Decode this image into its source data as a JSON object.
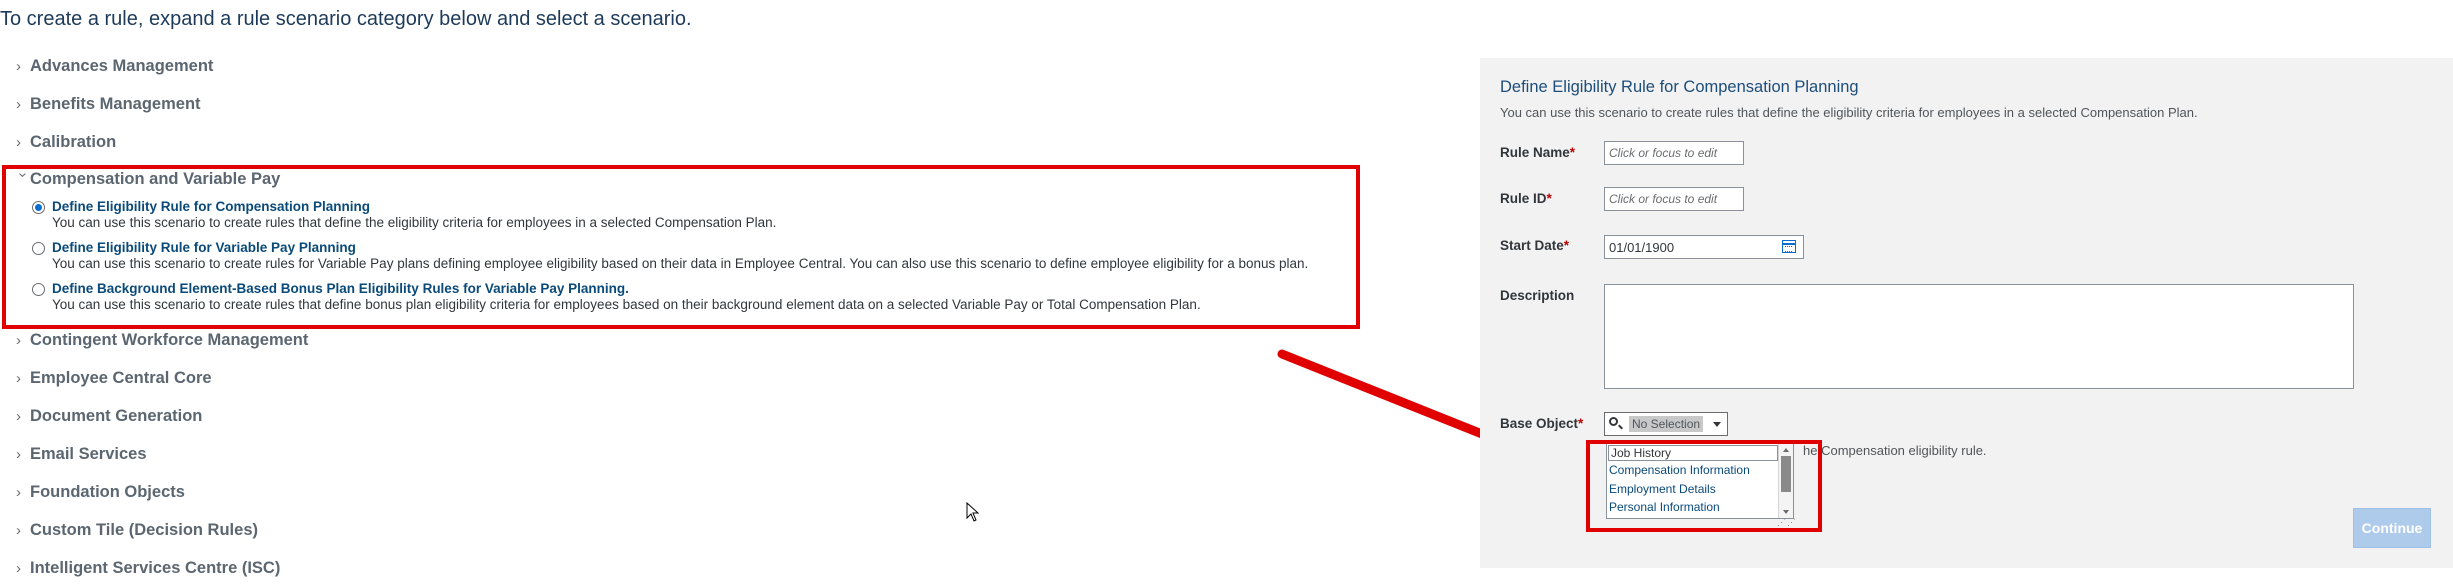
{
  "intro": "To create a rule, expand a rule scenario category below and select a scenario.",
  "categories_top": [
    "Advances Management",
    "Benefits Management",
    "Calibration"
  ],
  "expanded_category": {
    "label": "Compensation and Variable Pay",
    "options": [
      {
        "title": "Define Eligibility Rule for Compensation Planning",
        "desc": "You can use this scenario to create rules that define the eligibility criteria for employees in a selected Compensation Plan.",
        "selected": true
      },
      {
        "title": "Define Eligibility Rule for Variable Pay Planning",
        "desc": "You can use this scenario to create rules for Variable Pay plans defining employee eligibility based on their data in Employee Central. You can also use this scenario to define employee eligibility for a bonus plan.",
        "selected": false
      },
      {
        "title": "Define Background Element-Based Bonus Plan Eligibility Rules for Variable Pay Planning.",
        "desc": "You can use this scenario to create rules that define bonus plan eligibility criteria for employees based on their background element data on a selected Variable Pay or Total Compensation Plan.",
        "selected": false
      }
    ]
  },
  "categories_bottom": [
    "Contingent Workforce Management",
    "Employee Central Core",
    "Document Generation",
    "Email Services",
    "Foundation Objects",
    "Custom Tile (Decision Rules)",
    "Intelligent Services Centre (ISC)"
  ],
  "panel": {
    "title": "Define Eligibility Rule for Compensation Planning",
    "subtitle": "You can use this scenario to create rules that define the eligibility criteria for employees in a selected Compensation Plan.",
    "rule_name_label": "Rule Name",
    "rule_name_placeholder": "Click or focus to edit",
    "rule_id_label": "Rule ID",
    "rule_id_placeholder": "Click or focus to edit",
    "start_date_label": "Start Date",
    "start_date_value": "01/01/1900",
    "description_label": "Description",
    "base_object_label": "Base Object",
    "base_object_value": "No Selection",
    "required_mark": "*",
    "dropdown_items": [
      "Job History",
      "Compensation Information",
      "Employment Details",
      "Personal Information"
    ],
    "hint_visible": "he Compensation eligibility rule.",
    "continue_label": "Continue"
  },
  "colors": {
    "accent": "#0a6ed1",
    "annotation_red": "#e00000",
    "panel_bg": "#f2f2f2",
    "continue_disabled": "#aecbeb"
  }
}
